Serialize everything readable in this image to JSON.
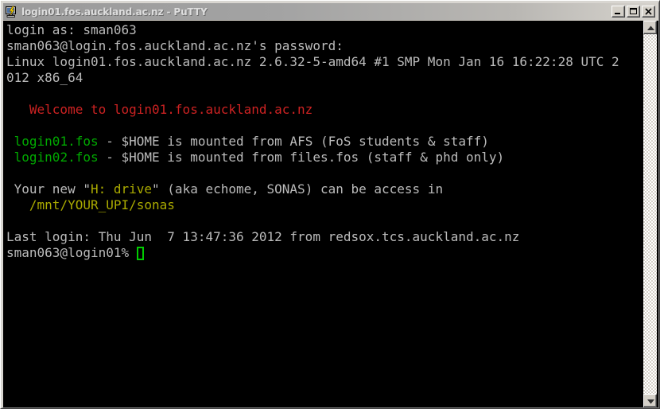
{
  "window": {
    "title": "login01.fos.auckland.ac.nz - PuTTY",
    "icon": "putty-computer-icon",
    "state": "inactive",
    "buttons": {
      "minimize": "_",
      "maximize": "□",
      "close": "×"
    }
  },
  "colors": {
    "terminal_background": "#000000",
    "terminal_foreground": "#bbbbbb",
    "ansi_red": "#cc2222",
    "ansi_green": "#00aa00",
    "ansi_yellow": "#aaaa00",
    "cursor": "#00cc00",
    "titlebar_text": "#dedede",
    "window_face": "#d4d0c8"
  },
  "terminal": {
    "lines": [
      {
        "id": "line-login-as",
        "segments": [
          {
            "text": "login as: sman063",
            "color": "white"
          }
        ]
      },
      {
        "id": "line-password-prompt",
        "segments": [
          {
            "text": "sman063@login.fos.auckland.ac.nz's password:",
            "color": "white"
          }
        ]
      },
      {
        "id": "line-uname-1",
        "segments": [
          {
            "text": "Linux login01.fos.auckland.ac.nz 2.6.32-5-amd64 #1 SMP Mon Jan 16 16:22:28 UTC 2",
            "color": "white"
          }
        ]
      },
      {
        "id": "line-uname-2",
        "segments": [
          {
            "text": "012 x86_64",
            "color": "white"
          }
        ]
      },
      {
        "id": "line-blank-1",
        "segments": [
          {
            "text": "",
            "color": "white"
          }
        ]
      },
      {
        "id": "line-welcome",
        "segments": [
          {
            "text": "   Welcome to login01.fos.auckland.ac.nz",
            "color": "red"
          }
        ]
      },
      {
        "id": "line-blank-2",
        "segments": [
          {
            "text": "",
            "color": "white"
          }
        ]
      },
      {
        "id": "line-login01",
        "segments": [
          {
            "text": " ",
            "color": "white"
          },
          {
            "text": "login01.fos",
            "color": "green"
          },
          {
            "text": " - $HOME is mounted from AFS (FoS students & staff)",
            "color": "white"
          }
        ]
      },
      {
        "id": "line-login02",
        "segments": [
          {
            "text": " ",
            "color": "white"
          },
          {
            "text": "login02.fos",
            "color": "green"
          },
          {
            "text": " - $HOME is mounted from files.fos (staff & phd only)",
            "color": "white"
          }
        ]
      },
      {
        "id": "line-blank-3",
        "segments": [
          {
            "text": "",
            "color": "white"
          }
        ]
      },
      {
        "id": "line-hdrive",
        "segments": [
          {
            "text": " Your new \"",
            "color": "white"
          },
          {
            "text": "H: drive",
            "color": "yellow"
          },
          {
            "text": "\" (aka echome, SONAS) can be access in",
            "color": "white"
          }
        ]
      },
      {
        "id": "line-hdrive-path",
        "segments": [
          {
            "text": "   ",
            "color": "white"
          },
          {
            "text": "/mnt/YOUR_UPI/sonas",
            "color": "yellow"
          }
        ]
      },
      {
        "id": "line-blank-4",
        "segments": [
          {
            "text": "",
            "color": "white"
          }
        ]
      },
      {
        "id": "line-last-login",
        "segments": [
          {
            "text": "Last login: Thu Jun  7 13:47:36 2012 from redsox.tcs.auckland.ac.nz",
            "color": "white"
          }
        ]
      },
      {
        "id": "line-prompt",
        "segments": [
          {
            "text": "sman063@login01% ",
            "color": "white"
          }
        ],
        "cursor": true
      }
    ]
  },
  "scrollbar": {
    "up_arrow": "scroll-up-arrow-icon",
    "down_arrow": "scroll-down-arrow-icon",
    "thumb_visible": false
  }
}
